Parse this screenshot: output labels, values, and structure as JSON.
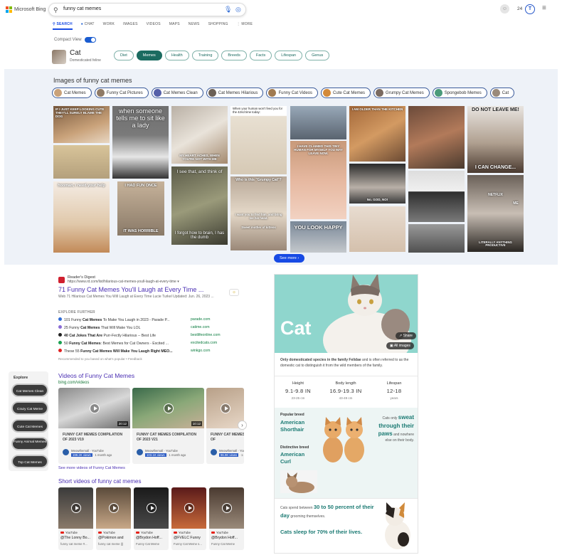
{
  "header": {
    "brand": "Microsoft Bing",
    "query": "funny cat memes",
    "rewards_count": "24"
  },
  "tabs": [
    {
      "label": "SEARCH",
      "active": true
    },
    {
      "label": "CHAT"
    },
    {
      "label": "WORK"
    },
    {
      "label": "IMAGES"
    },
    {
      "label": "VIDEOS"
    },
    {
      "label": "MAPS"
    },
    {
      "label": "NEWS"
    },
    {
      "label": "SHOPPING"
    },
    {
      "label": "⋮ MORE"
    }
  ],
  "compact_view_label": "Compact View",
  "entity": {
    "title": "Cat",
    "subtitle": "Domesticated feline",
    "chips": [
      {
        "label": "Diet"
      },
      {
        "label": "Memes",
        "active": true
      },
      {
        "label": "Health"
      },
      {
        "label": "Training"
      },
      {
        "label": "Breeds"
      },
      {
        "label": "Facts"
      },
      {
        "label": "Lifespan"
      },
      {
        "label": "Genus"
      }
    ]
  },
  "images": {
    "title": "Images of funny cat memes",
    "chips": [
      "Cat Memes",
      "Funny Cat Pictures",
      "Cat Memes Clean",
      "Cat Memes Hilarious",
      "Funny Cat Videos",
      "Cute Cat Memes",
      "Grumpy Cat Memes",
      "Spongebob Memes",
      "Cat"
    ],
    "captions": {
      "t1": "IF I JUST KEEP LOOKING CUTE THEY'LL SURELY BLAME THE DOG",
      "t2": "when someone tells me to sit like a lady",
      "t3": "MY HEART ACHES, WHEN YOU'RE NOT WITH ME",
      "t4": "When your human won't feed you for the 42nd time today:",
      "t5": "I HAVE CLAIMED THIS TINY HUMAN FOR MYSELF YOU MAY LEAVE NOW.",
      "t6": "I AM OLDER THAN THE KITCHEN",
      "t7": "DO NOT LEAVE ME!",
      "t7b": "I CAN CHANGE...",
      "t8": "hooman, i need your help",
      "t9": "I HAD FUN ONCE",
      "t9b": "IT WAS HORRIBLE",
      "t10": "I see that, and think of",
      "t10b": "I forgot how to brain, I has the dumb",
      "t11": "Who is this \"Grumpy Cat\"?",
      "t11b": "I want you to find him, and bring me his head.",
      "t11c": "Sweet mother of kittens",
      "t12": "YOU LOOK HAPPY",
      "t13": "NETFLIX",
      "t13b": "ME",
      "t13c": "LITERALLY ANYTHING PRODUCTIVE",
      "t14": "No. GOD, NO!"
    },
    "see_more": "See more"
  },
  "result": {
    "source": "Reader's Digest",
    "url": "https://www.rd.com/list/hilarious-cat-memes-youll-laugh-at-every-time ▾",
    "title": "71 Funny Cat Memes You'll Laugh at Every Time ...",
    "snippet": "Web 71 Hilarious Cat Memes You Will Laugh at Every Time Lucie Turkel Updated: Jun. 26, 2023 ..."
  },
  "explore": {
    "heading": "EXPLORE FURTHER",
    "rows": [
      {
        "pre": "101 Funny ",
        "bold": "Cat Memes",
        "post": " To Make You Laugh in 2023 - Parade P...",
        "domain": "parade.com",
        "color": "#2f6bd5"
      },
      {
        "pre": "25 Funny ",
        "bold": "Cat Memes",
        "post": " That Will Make You LOL",
        "domain": "catime.com",
        "color": "#8a6bd5"
      },
      {
        "pre": "",
        "bold": "40 Cat Jokes That Are",
        "post": " Purr-Fectly Hilarious -- Best Life",
        "domain": "bestlifeonline.com",
        "color": "#222222"
      },
      {
        "pre": "50 ",
        "bold": "Funny Cat Memes",
        "post": ": Best Memes for Cat Owners - Excited ...",
        "domain": "excitedcats.com",
        "color": "#1aa051"
      },
      {
        "pre": "These 55 ",
        "bold": "Funny Cat Memes Will Make You Laugh Right MEO...",
        "post": "",
        "domain": "winkgo.com",
        "color": "#e02020"
      }
    ],
    "note": "Recommended to you based on what's popular • Feedback"
  },
  "explore_panel": {
    "heading": "Explore",
    "items": [
      "Cat Memes Clean",
      "Crazy Cat Meme",
      "Cute Cat Memes",
      "Funny Animal Memes",
      "Top Cat Memes"
    ]
  },
  "videos": {
    "title": "Videos of Funny Cat Memes",
    "source": "bing.com/videos",
    "cards": [
      {
        "title": "FUNNY CAT MEMES COMPILATION OF 2023 V19",
        "channel": "Meowthemall · YouTube",
        "views": "199.2K views",
        "ago": "· 1 month ago",
        "duration": "20:12"
      },
      {
        "title": "FUNNY CAT MEMES COMPILATION OF 2023 V21",
        "channel": "Meowthemall · YouTube",
        "views": "103.1K views",
        "ago": "· 1 month ago",
        "duration": "10:12"
      },
      {
        "title": "FUNNY CAT MEMES COMPILATION OF",
        "channel": "Meowthemall · YouTube",
        "views": "96.9K views",
        "ago": "· 1 month",
        "duration": ""
      }
    ],
    "see_more": "See more videos of Funny Cat Memes"
  },
  "shorts": {
    "title": "Short videos of funny cat memes",
    "cards": [
      {
        "platform": "YouTube",
        "name": "@The Lonny Bo...",
        "desc": "funny cat meme #..."
      },
      {
        "platform": "YouTube",
        "name": "@Pokimon and",
        "desc": "funny cat meme |||"
      },
      {
        "platform": "YouTube",
        "name": "@Brydon Hoff...",
        "desc": "Funny Cat Meme"
      },
      {
        "platform": "YouTube",
        "name": "@FVELC Funny",
        "desc": "Funny Cat Meme s..."
      },
      {
        "platform": "YouTube",
        "name": "@Brydon Hoff...",
        "desc": "Funny Cat Meme"
      }
    ]
  },
  "knowledge_panel": {
    "title": "Cat",
    "share": "Share",
    "all_images": "All images",
    "desc_bold": "Only domesticated species in the family Felidae",
    "desc_rest": " and is often referred to as the domestic cat to distinguish it from the wild members of the family.",
    "stats": [
      {
        "label": "Height",
        "value": "9.1-9.8 IN",
        "sub": "23-25 cm"
      },
      {
        "label": "Body length",
        "value": "16.9-19.3 IN",
        "sub": "43-49 cm"
      },
      {
        "label": "Lifespan",
        "value": "12-18",
        "sub": "years"
      }
    ],
    "popular_label": "Popular breed",
    "popular_value": "American Shorthair",
    "distinctive_label": "Distinctive breed",
    "distinctive_value": "American Curl",
    "sweat_pre": "Cats only",
    "sweat_bold": "sweat through their paws",
    "sweat_post": "and nowhere else on their body.",
    "fact1_pre": "Cats spend between",
    "fact1_bold": "30 to 50 percent of their day",
    "fact1_post": "grooming themselves.",
    "fact2": "Cats sleep for 70% of their lives."
  }
}
